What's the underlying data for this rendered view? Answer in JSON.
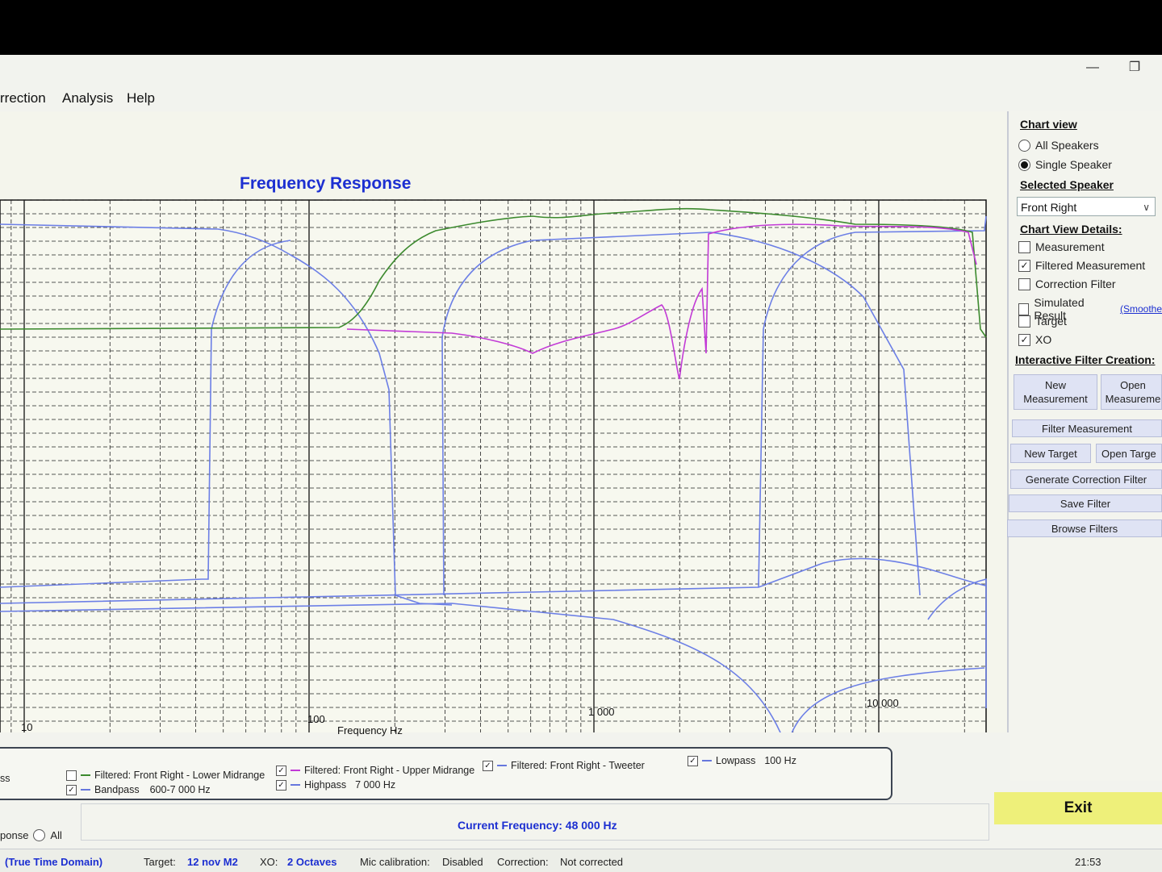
{
  "window": {
    "minimize_glyph": "—",
    "restore_glyph": "❐"
  },
  "menu": {
    "items": [
      "rrection",
      "Analysis",
      "Help"
    ]
  },
  "chart": {
    "title": "Frequency Response",
    "xlabel": "Frequency Hz",
    "tick_labels": [
      "10",
      "100",
      "1 000",
      "10 000"
    ]
  },
  "chart_data": {
    "type": "line",
    "title": "Frequency Response",
    "xlabel": "Frequency Hz",
    "ylabel": "",
    "x_scale": "log",
    "xlim": [
      4,
      20000
    ],
    "x_ticks": [
      10,
      100,
      1000,
      10000
    ],
    "grid": true,
    "series": [
      {
        "name": "Filtered: Front Right - Lower Midrange",
        "color": "#3c8a2e"
      },
      {
        "name": "Filtered: Front Right - Upper Midrange",
        "color": "#c23ad6"
      },
      {
        "name": "Filtered: Front Right - Tweeter",
        "color": "#6c7fe6"
      },
      {
        "name": "Bandpass 600-7 000 Hz",
        "color": "#6c7fe6"
      },
      {
        "name": "Highpass 7 000 Hz",
        "color": "#6c7fe6"
      },
      {
        "name": "Lowpass 100 Hz",
        "color": "#6c7fe6"
      }
    ]
  },
  "side": {
    "chart_view_head": "Chart view",
    "all_speakers": "All Speakers",
    "single_speaker": "Single Speaker",
    "selected_head": "Selected Speaker",
    "speaker_value": "Front Right",
    "details_head": "Chart View Details:",
    "measurement": "Measurement",
    "filtered_measurement": "Filtered Measurement",
    "correction_filter": "Correction Filter",
    "simulated_result": "Simulated Result",
    "smoothed": "(Smoothe",
    "target": "Target",
    "xo": "XO",
    "interactive_head": "Interactive Filter Creation:",
    "new_measurement": "New Measurement",
    "open_measurement": "Open Measureme",
    "filter_measurement": "Filter Measurement",
    "new_target": "New Target",
    "open_target": "Open Targe",
    "generate_correction": "Generate Correction Filter",
    "save_filter": "Save Filter",
    "browse_filters": "Browse Filters"
  },
  "legend": {
    "left_fragment": "ss",
    "lower_mid": "Filtered: Front Right - Lower Midrange",
    "upper_mid": "Filtered: Front Right - Upper Midrange",
    "tweeter": "Filtered: Front Right - Tweeter",
    "lowpass": "Lowpass",
    "lowpass_val": "100 Hz",
    "bandpass": "Bandpass",
    "bandpass_val": "600-7 000 Hz",
    "highpass": "Highpass",
    "highpass_val": "7 000 Hz"
  },
  "response": {
    "label": "ponse",
    "all": "All"
  },
  "current_frequency": "Current Frequency: 48 000 Hz",
  "exit_label": "Exit",
  "status": {
    "mode": "(True Time Domain)",
    "target_label": "Target:",
    "target_value": "12 nov M2",
    "xo_label": "XO:",
    "xo_value": "2 Octaves",
    "mic_label": "Mic calibration:",
    "mic_value": "Disabled",
    "correction_label": "Correction:",
    "correction_value": "Not corrected",
    "clock": "21:53"
  }
}
